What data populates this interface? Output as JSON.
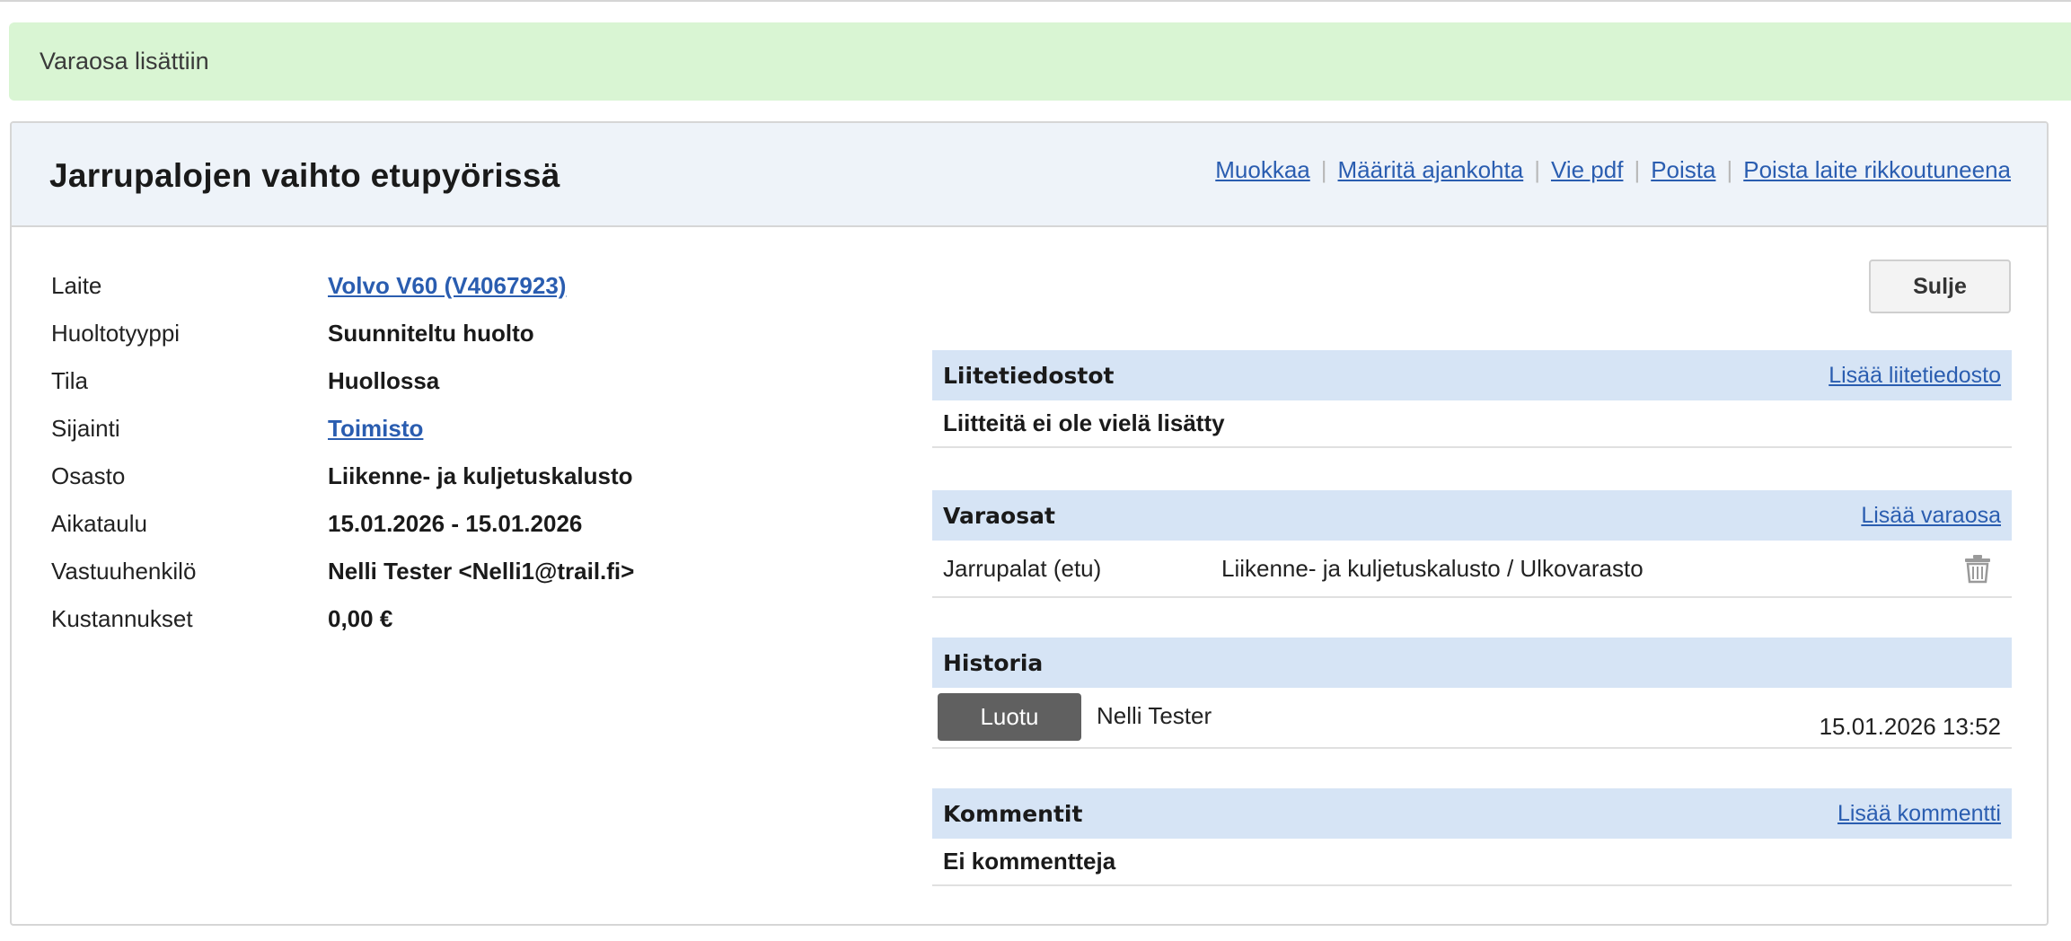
{
  "alert": {
    "message": "Varaosa lisättiin"
  },
  "panel": {
    "title": "Jarrupalojen vaihto etupyörissä",
    "actions": [
      "Muokkaa",
      "Määritä ajankohta",
      "Vie pdf",
      "Poista",
      "Poista laite rikkoutuneena"
    ]
  },
  "details": [
    {
      "label": "Laite",
      "value": "Volvo V60 (V4067923)"
    },
    {
      "label": "Huoltotyyppi",
      "value": "Suunniteltu huolto"
    },
    {
      "label": "Tila",
      "value": "Huollossa"
    },
    {
      "label": "Sijainti",
      "value": "Toimisto"
    },
    {
      "label": "Osasto",
      "value": "Liikenne- ja kuljetuskalusto"
    },
    {
      "label": "Aikataulu",
      "value": "15.01.2026 - 15.01.2026"
    },
    {
      "label": "Vastuuhenkilö",
      "value": "Nelli Tester <Nelli1@trail.fi>"
    },
    {
      "label": "Kustannukset",
      "value": "0,00 €"
    }
  ],
  "close_button": "Sulje",
  "attachments": {
    "title": "Liitetiedostot",
    "add_link": "Lisää liitetiedosto",
    "empty_text": "Liitteitä ei ole vielä lisätty"
  },
  "spare_parts": {
    "title": "Varaosat",
    "add_link": "Lisää varaosa",
    "items": [
      {
        "name": "Jarrupalat (etu)",
        "location": "Liikenne- ja kuljetuskalusto / Ulkovarasto",
        "icon": "trash-icon"
      }
    ]
  },
  "history": {
    "title": "Historia",
    "entries": [
      {
        "event": "Luotu",
        "user": "Nelli Tester",
        "timestamp": "15.01.2026 13:52"
      }
    ]
  },
  "comments": {
    "title": "Kommentit",
    "add_link": "Lisää kommentti",
    "empty_text": "Ei kommentteja"
  },
  "colors": {
    "alert_bg": "#d9f5d3",
    "section_header": "#d6e4f5",
    "link": "#2a5db0",
    "badge": "#606060"
  }
}
